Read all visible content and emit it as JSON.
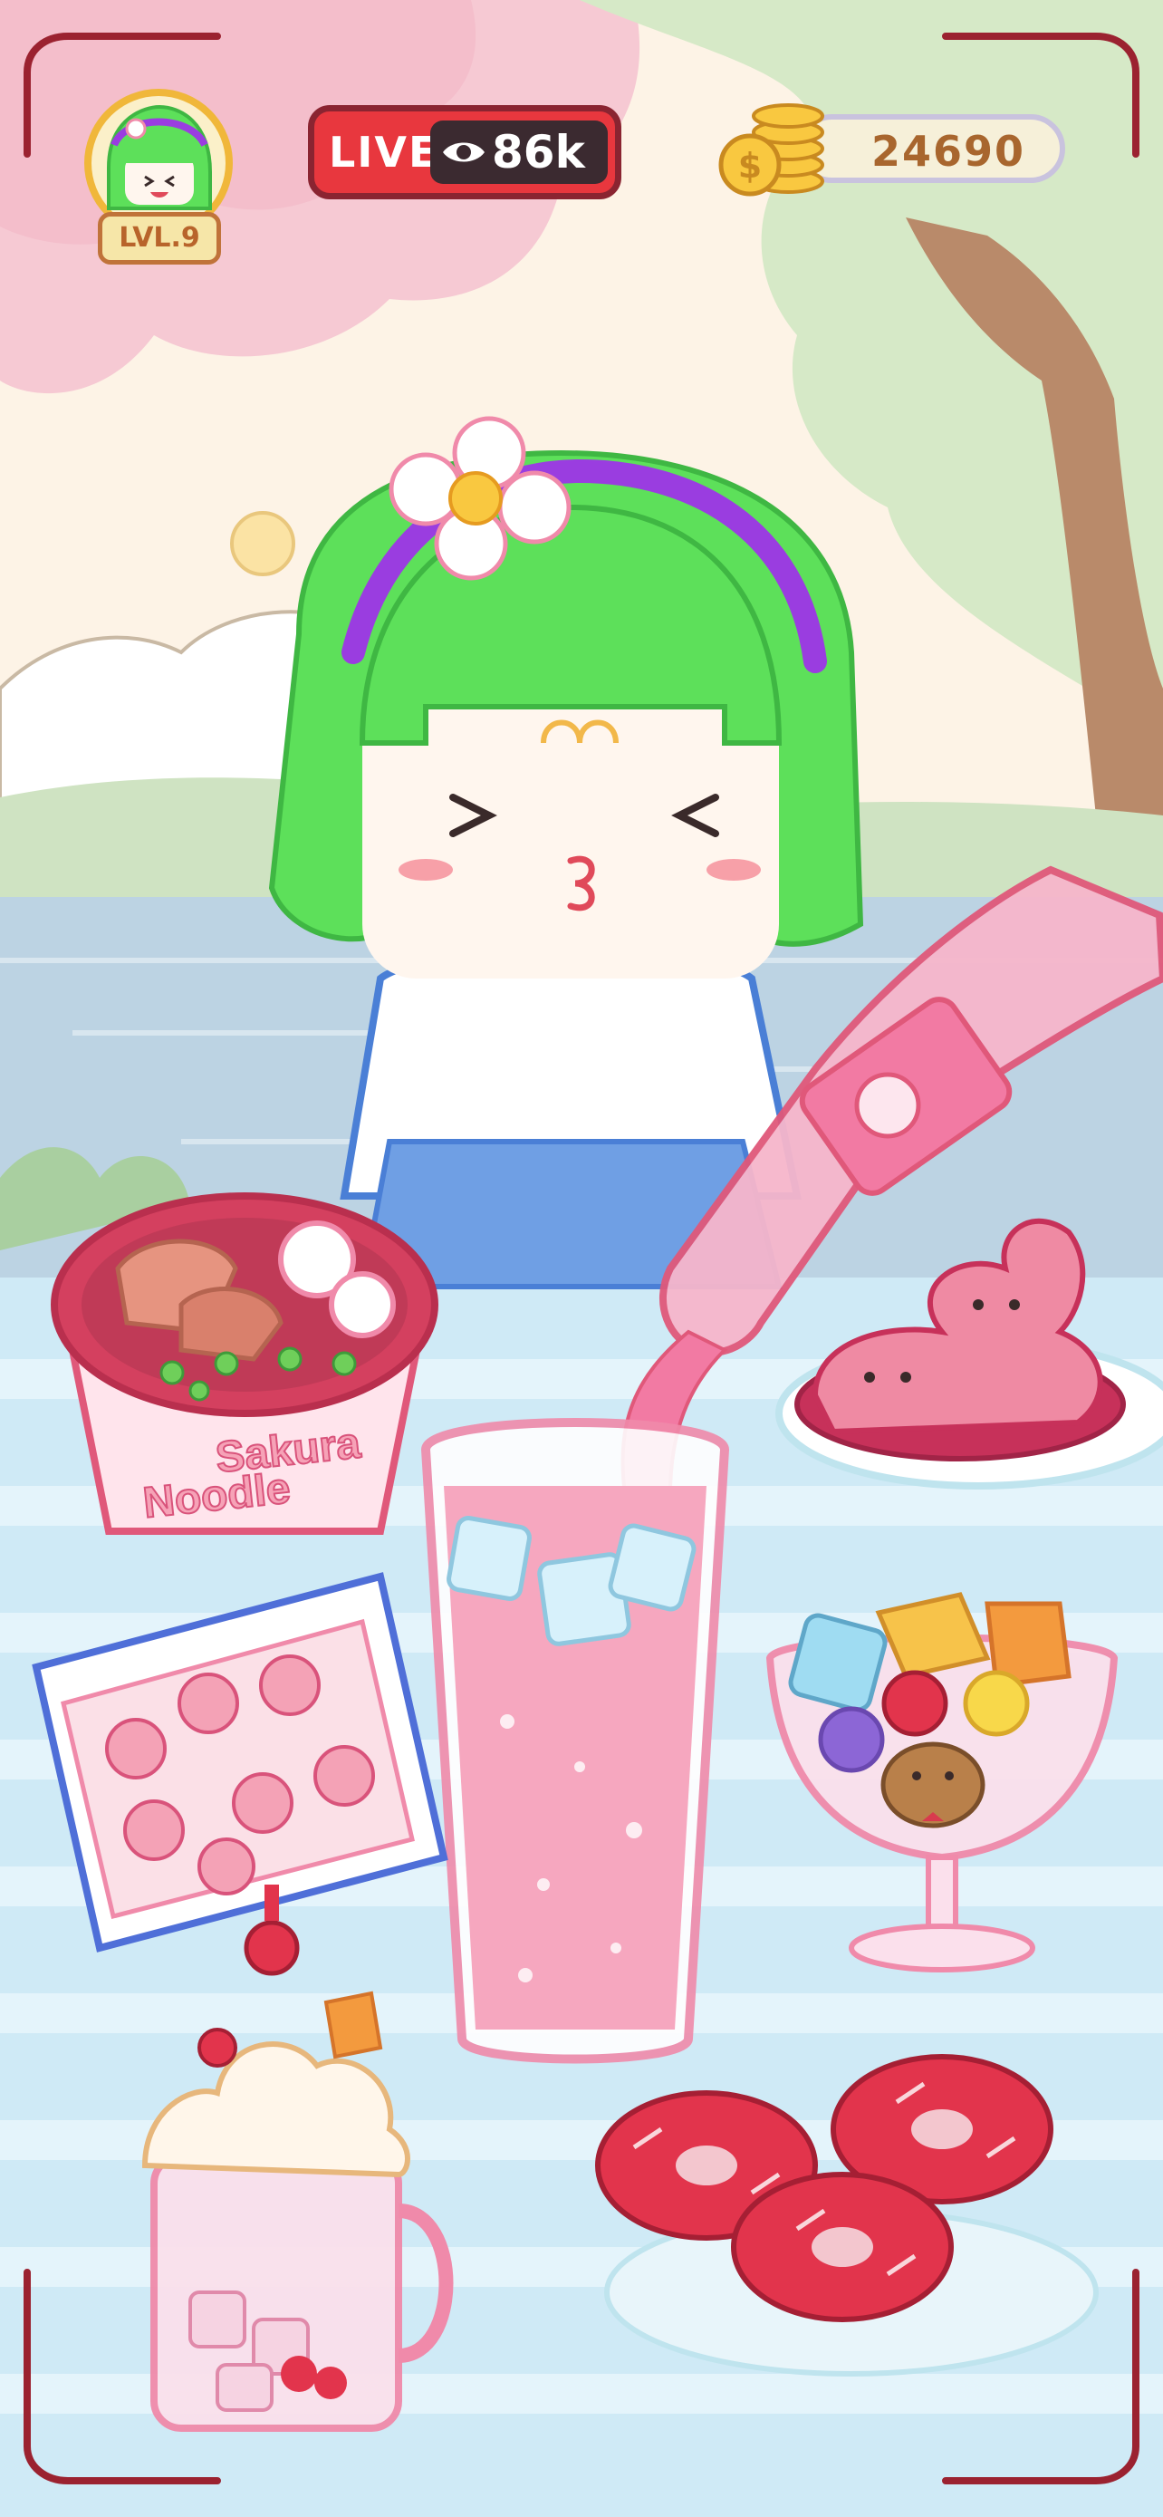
{
  "hud": {
    "level_label": "LVL.9",
    "live_label": "LIVE",
    "viewer_count": "86k",
    "coin_count": "24690"
  },
  "noodle_cup": {
    "brand_line1": "Sakura",
    "brand_line2": "Noodle"
  },
  "colors": {
    "sky": "#fdf3e6",
    "blossom": "#f6c9d3",
    "tree_green": "#d6e9c7",
    "water": "#bcd3e3",
    "table": "#cfeaf6",
    "table_stripe": "#e4f4fb",
    "hair": "#5de05a",
    "headband": "#9a3de0",
    "live_red": "#e8373e",
    "soda_pink": "#f27aa3",
    "frame_red": "#9b2230"
  },
  "icons": [
    "avatar-portrait-icon",
    "eye-icon",
    "coin-stack-icon",
    "viewfinder-corner-icon"
  ]
}
